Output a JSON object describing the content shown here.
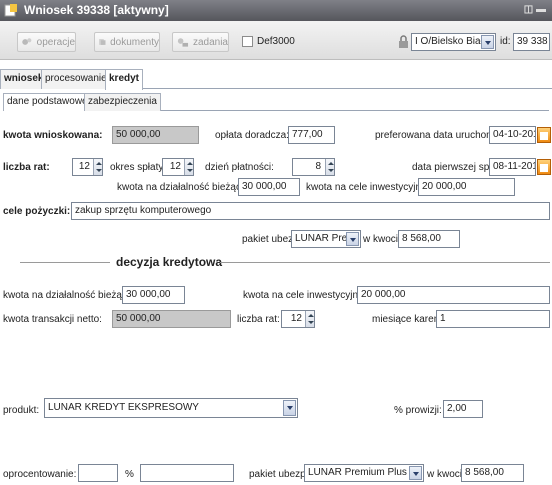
{
  "window": {
    "title": "Wniosek 39338 [aktywny]",
    "controls": "◫ ▬"
  },
  "toolbar": {
    "operacje": "operacje",
    "dokumenty": "dokumenty",
    "zadania": "zadania",
    "def3000": "Def3000",
    "branch": "I O/Bielsko Biała",
    "id_label": "id:",
    "id_value": "39 338"
  },
  "tabs": [
    "wniosek",
    "procesowanie",
    "kredyt"
  ],
  "subtabs": [
    "dane podstawowe",
    "zabezpieczenia"
  ],
  "form": {
    "kwota_wnioskowana_label": "kwota wnioskowana:",
    "kwota_wnioskowana_value": "50 000,00",
    "oplata_label": "opłata doradcza:",
    "oplata_value": "777,00",
    "pref_data_label": "preferowana data uruchomienia:",
    "pref_data_value": "04-10-2010",
    "liczba_rat_label": "liczba rat:",
    "liczba_rat_value": "12",
    "okres_label": "okres spłaty:",
    "okres_value": "12",
    "dzien_label": "dzień płatności:",
    "dzien_value": "8",
    "pierwsza_label": "data pierwszej spłaty:",
    "pierwsza_value": "08-11-2010",
    "dzialalnosc_label": "kwota na działalność bieżącą:",
    "dzialalnosc_value": "30 000,00",
    "inwest_label": "kwota na cele inwestycyjne:",
    "inwest_value": "20 000,00",
    "cele_label": "cele pożyczki:",
    "cele_value": "zakup sprzętu komputerowego",
    "pakiet_label": "pakiet ubezp.:",
    "pakiet_value": "LUNAR Pre...",
    "wkwocie_label": "w kwocie:",
    "wkwocie_value": "8 568,00"
  },
  "decyzja": {
    "title": "decyzja kredytowa",
    "dzialalnosc_label": "kwota na działalność bieżącą:",
    "dzialalnosc_value": "30 000,00",
    "inwest_label": "kwota na cele inwestycyjne:",
    "inwest_value": "20 000,00",
    "netto_label": "kwota transakcji netto:",
    "netto_value": "50 000,00",
    "liczba_rat_label": "liczba rat:",
    "liczba_rat_value": "12",
    "karencji_label": "miesiące karencji:",
    "karencji_value": "1",
    "produkt_label": "produkt:",
    "produkt_value": "LUNAR KREDYT EKSPRESOWY",
    "prowizji_label": "% prowizji:",
    "prowizji_value": "2,00",
    "oprocentowanie_label": "oprocentowanie:",
    "oprocentowanie_value": "",
    "percent_sign": "%",
    "percent_value": "",
    "pakiet_label": "pakiet ubezp.:",
    "pakiet_value": "LUNAR Premium Plus",
    "wkwocie_label": "w kwocie:",
    "wkwocie_value": "8 568,00"
  }
}
